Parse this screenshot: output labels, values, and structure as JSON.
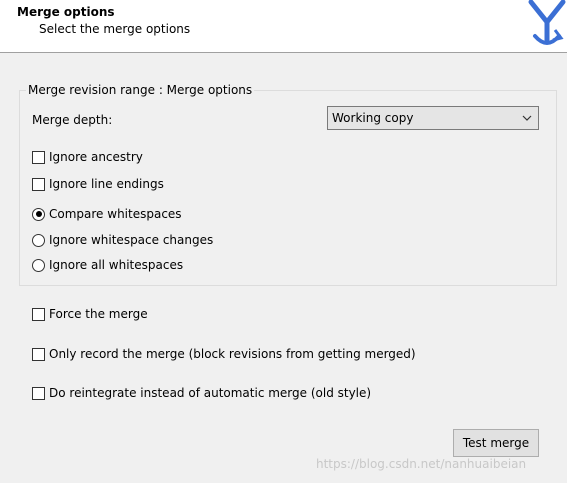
{
  "header": {
    "title": "Merge options",
    "subtitle": "Select the merge options"
  },
  "group": {
    "title": "Merge revision range : Merge options",
    "depth_label": "Merge depth:",
    "depth_value": "Working copy",
    "ignore_ancestry": {
      "label": "Ignore ancestry",
      "checked": false
    },
    "ignore_line_endings": {
      "label": "Ignore line endings",
      "checked": false
    },
    "whitespace_options": [
      {
        "label": "Compare whitespaces",
        "selected": true
      },
      {
        "label": "Ignore whitespace changes",
        "selected": false
      },
      {
        "label": "Ignore all whitespaces",
        "selected": false
      }
    ]
  },
  "options": {
    "force_merge": {
      "label": "Force the merge",
      "checked": false
    },
    "record_only": {
      "label": "Only record the merge (block revisions from getting merged)",
      "checked": false
    },
    "reintegrate": {
      "label": "Do reintegrate instead of automatic merge (old style)",
      "checked": false
    }
  },
  "buttons": {
    "test_merge": "Test merge"
  },
  "watermark": "https://blog.csdn.net/nanhuaibeian"
}
